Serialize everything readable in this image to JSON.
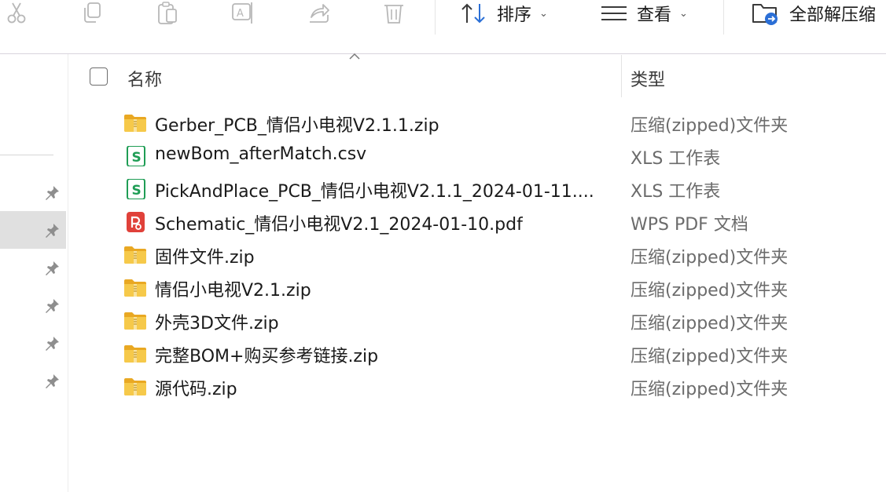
{
  "toolbar": {
    "icons": [
      {
        "name": "cut-icon"
      },
      {
        "name": "copy-icon"
      },
      {
        "name": "paste-icon"
      },
      {
        "name": "rename-icon"
      },
      {
        "name": "share-icon"
      },
      {
        "name": "delete-icon"
      }
    ],
    "sort_label": "排序",
    "view_label": "查看",
    "extract_label": "全部解压缩"
  },
  "header": {
    "name_label": "名称",
    "type_label": "类型"
  },
  "files": [
    {
      "name": "Gerber_PCB_情侣小电视V2.1.1.zip",
      "type": "压缩(zipped)文件夹",
      "icon": "zip-folder-icon"
    },
    {
      "name": "newBom_afterMatch.csv",
      "type": "XLS 工作表",
      "icon": "spreadsheet-icon"
    },
    {
      "name": "PickAndPlace_PCB_情侣小电视V2.1.1_2024-01-11....",
      "type": "XLS 工作表",
      "icon": "spreadsheet-icon"
    },
    {
      "name": "Schematic_情侣小电视V2.1_2024-01-10.pdf",
      "type": "WPS PDF 文档",
      "icon": "pdf-icon"
    },
    {
      "name": "固件文件.zip",
      "type": "压缩(zipped)文件夹",
      "icon": "zip-folder-icon"
    },
    {
      "name": "情侣小电视V2.1.zip",
      "type": "压缩(zipped)文件夹",
      "icon": "zip-folder-icon"
    },
    {
      "name": "外壳3D文件.zip",
      "type": "压缩(zipped)文件夹",
      "icon": "zip-folder-icon"
    },
    {
      "name": "完整BOM+购买参考链接.zip",
      "type": "压缩(zipped)文件夹",
      "icon": "zip-folder-icon"
    },
    {
      "name": "源代码.zip",
      "type": "压缩(zipped)文件夹",
      "icon": "zip-folder-icon"
    }
  ],
  "nav": {
    "pins": 6
  },
  "colors": {
    "folder": "#f2c23c",
    "spreadsheet": "#1f9d55",
    "pdf": "#e0413a",
    "accent": "#2b6fd6"
  }
}
